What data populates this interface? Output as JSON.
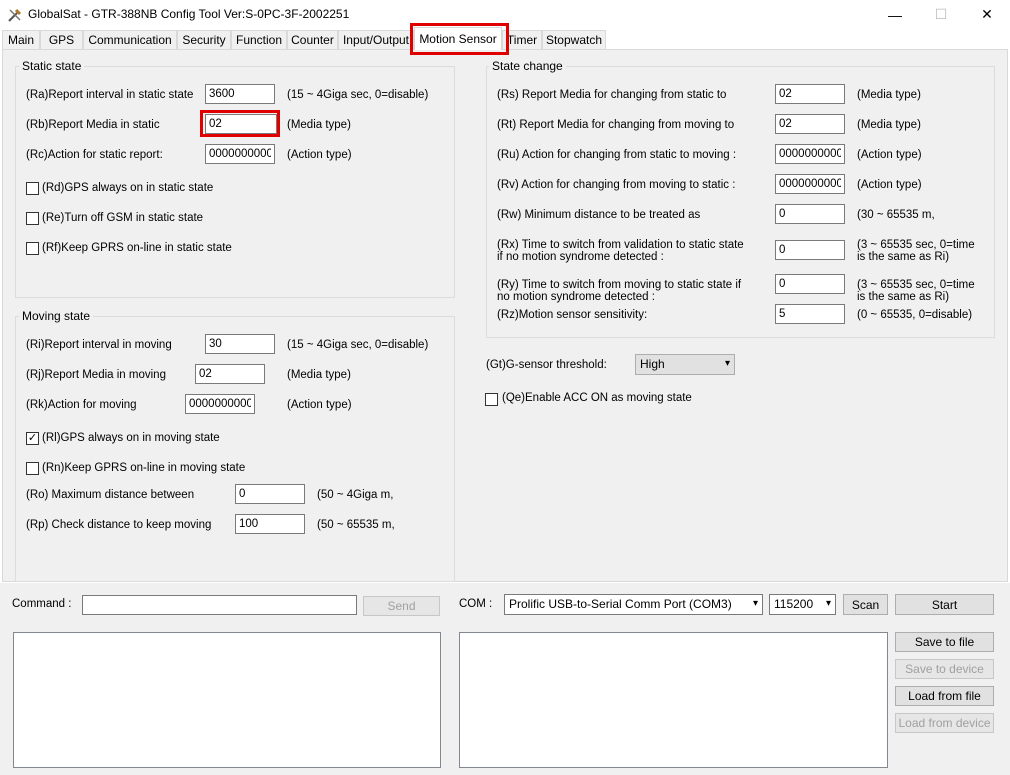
{
  "window": {
    "title": "GlobalSat - GTR-388NB Config Tool Ver:S-0PC-3F-2002251",
    "minimize_glyph": "—",
    "maximize_glyph": "☐",
    "close_glyph": "✕"
  },
  "tabs": [
    {
      "label": "Main"
    },
    {
      "label": "GPS"
    },
    {
      "label": "Communication"
    },
    {
      "label": "Security"
    },
    {
      "label": "Function"
    },
    {
      "label": "Counter"
    },
    {
      "label": "Input/Output"
    },
    {
      "label": "Motion Sensor"
    },
    {
      "label": "Timer"
    },
    {
      "label": "Stopwatch"
    }
  ],
  "active_tab": "Motion Sensor",
  "highlight_color": "#e00000",
  "static": {
    "title": "Static state",
    "ra_label": "(Ra)Report interval in static state",
    "ra_value": "3600",
    "ra_hint": "(15 ~ 4Giga sec, 0=disable)",
    "rb_label": "(Rb)Report Media in static",
    "rb_value": "02",
    "rb_hint": "(Media type)",
    "rc_label": "(Rc)Action for static report:",
    "rc_value": "0000000000",
    "rc_hint": "(Action type)",
    "rd_label": "(Rd)GPS always on in static state",
    "rd_checked": "",
    "re_label": "(Re)Turn off GSM in static state",
    "re_checked": "",
    "rf_label": "(Rf)Keep GPRS on-line in static state",
    "rf_checked": ""
  },
  "moving": {
    "title": "Moving state",
    "ri_label": "(Ri)Report interval in moving",
    "ri_value": "30",
    "ri_hint": "(15 ~ 4Giga sec, 0=disable)",
    "rj_label": "(Rj)Report Media in moving",
    "rj_value": "02",
    "rj_hint": "(Media type)",
    "rk_label": "(Rk)Action for moving",
    "rk_value": "0000000000",
    "rk_hint": "(Action type)",
    "rl_label": "(Rl)GPS always on in moving state",
    "rl_checked": "✓",
    "rn_label": "(Rn)Keep GPRS on-line in moving state",
    "rn_checked": "",
    "ro_label": "(Ro) Maximum distance between",
    "ro_value": "0",
    "ro_hint": "(50 ~ 4Giga m,",
    "rp_label": "(Rp) Check distance to keep moving",
    "rp_value": "100",
    "rp_hint": "(50 ~ 65535 m,"
  },
  "change": {
    "title": "State change",
    "rs_label": "(Rs) Report Media for changing from static to",
    "rs_value": "02",
    "rs_hint": "(Media type)",
    "rt_label": "(Rt) Report Media for changing from moving to",
    "rt_value": "02",
    "rt_hint": "(Media type)",
    "ru_label": "(Ru) Action for changing from static to moving :",
    "ru_value": "0000000000",
    "ru_hint": "(Action type)",
    "rv_label": "(Rv) Action for changing from moving to static :",
    "rv_value": "0000000000",
    "rv_hint": "(Action type)",
    "rw_label": "(Rw) Minimum distance to be treated as",
    "rw_value": "0",
    "rw_hint": "(30 ~ 65535 m,",
    "rx_label_1": "(Rx) Time to switch from validation to static state",
    "rx_label_2": "if no motion syndrome detected :",
    "rx_value": "0",
    "rx_hint_1": "(3 ~ 65535 sec, 0=time",
    "rx_hint_2": "is the same as Ri)",
    "ry_label_1": "(Ry) Time to switch from moving to static state if",
    "ry_label_2": "no motion syndrome detected :",
    "ry_value": "0",
    "ry_hint_1": "(3 ~ 65535 sec, 0=time",
    "ry_hint_2": "is the same as Ri)",
    "rz_label": "(Rz)Motion sensor sensitivity:",
    "rz_value": "5",
    "rz_hint": "(0 ~ 65535, 0=disable)"
  },
  "gsensor": {
    "label": "(Gt)G-sensor threshold:",
    "value": "High"
  },
  "acc": {
    "label": "(Qe)Enable ACC ON as moving state",
    "checked": ""
  },
  "bottom": {
    "command_label": "Command :",
    "command_value": "",
    "send_label": "Send",
    "com_label": "COM :",
    "com_port": "Prolific USB-to-Serial Comm Port (COM3)",
    "baud": "115200",
    "scan_label": "Scan",
    "start_label": "Start",
    "save_file_label": "Save to file",
    "save_device_label": "Save to device",
    "load_file_label": "Load from file",
    "load_device_label": "Load from device"
  }
}
